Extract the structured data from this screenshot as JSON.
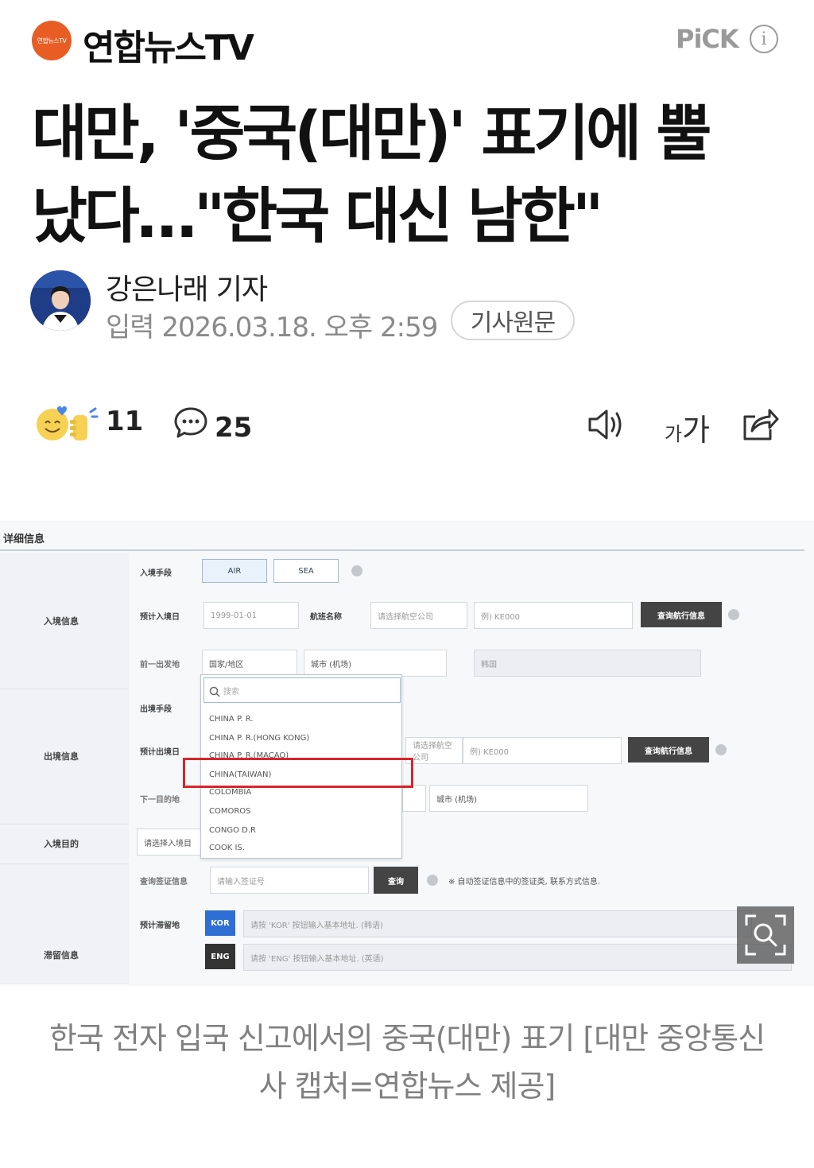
{
  "header": {
    "logo_text": "연합뉴스TV",
    "brand": "연합뉴스TV",
    "pick_label": "PiCK",
    "info_glyph": "i",
    "accent_color": "#e85d24"
  },
  "article": {
    "headline_line1": "대만, '중국(대만)' 표기에 뿔",
    "headline_line2": "났다…\"한국 대신 남한\"",
    "author": "강은나래 기자",
    "published": "입력 2026.03.18. 오후 2:59",
    "original_button": "기사원문"
  },
  "actions": {
    "reaction_count": "11",
    "comment_count": "25",
    "font_small": "가",
    "font_big": "가"
  },
  "figure": {
    "section_title": "详细信息",
    "entry_info": "入境信息",
    "exit_info": "出境信息",
    "stay_info": "滞留信息",
    "entry_method": "入境手段",
    "air": "AIR",
    "sea": "SEA",
    "expected_entry_date": "预计入境日",
    "date_placeholder": "1999-01-01",
    "flight_name": "航班名称",
    "airline_placeholder": "请选择航空公司",
    "flight_placeholder": "例) KE000",
    "query_flight": "查询航行信息",
    "prev_departure": "前一出发地",
    "country_region": "国家/地区",
    "city_airport": "城市 (机场)",
    "korea_field": "韩国",
    "search_placeholder": "搜索",
    "exit_method": "出境手段",
    "expected_exit_date": "预计出境日",
    "next_destination": "下一目的地",
    "entry_purpose": "入境目的",
    "select_purpose": "请选择入境目",
    "visa_query": "查询签证信息",
    "visa_placeholder": "请输入签证号",
    "query": "查询",
    "visa_note": "※ 自动签证信息中的签证类, 联系方式信息.",
    "expected_stay": "预计滞留地",
    "kor": "KOR",
    "eng": "ENG",
    "kor_placeholder": "请按 'KOR' 按钮输入基本地址. (韩语)",
    "eng_placeholder": "请按 'ENG' 按钮输入基本地址. (英语)",
    "countries": [
      "CHINA P. R.",
      "CHINA P. R.(HONG KONG)",
      "CHINA P. R.(MACAO)",
      "CHINA(TAIWAN)",
      "COLOMBIA",
      "COMOROS",
      "CONGO D.R",
      "COOK IS."
    ],
    "highlight_color": "#d7262b"
  },
  "caption": {
    "text": "한국 전자 입국 신고에서의 중국(대만) 표기 [대만 중앙통신사 캡처=연합뉴스 제공]"
  }
}
